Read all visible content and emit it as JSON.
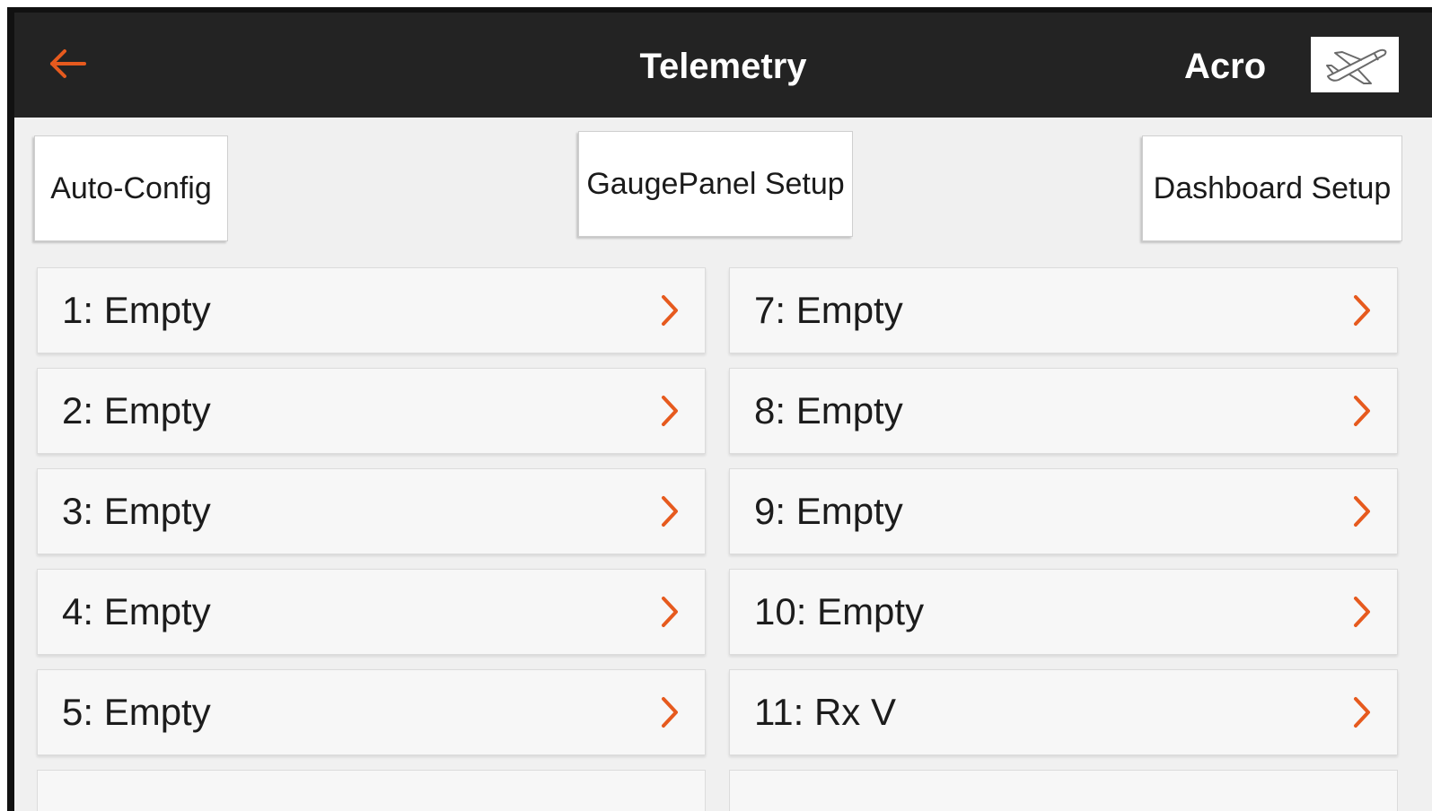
{
  "header": {
    "title": "Telemetry",
    "model_name": "Acro",
    "back_icon": "arrow-left-icon",
    "model_icon": "airplane-icon"
  },
  "toolbar": {
    "auto_config_label": "Auto-Config",
    "gauge_panel_setup_label": "GaugePanel Setup",
    "dashboard_setup_label": "Dashboard Setup"
  },
  "slots": {
    "left": [
      "1: Empty",
      "2: Empty",
      "3: Empty",
      "4: Empty",
      "5: Empty"
    ],
    "right": [
      "7: Empty",
      "8: Empty",
      "9: Empty",
      "10: Empty",
      "11: Rx V"
    ]
  },
  "colors": {
    "accent": "#e65a1e",
    "header_bg": "#232323",
    "screen_bg": "#f0f0f0"
  }
}
